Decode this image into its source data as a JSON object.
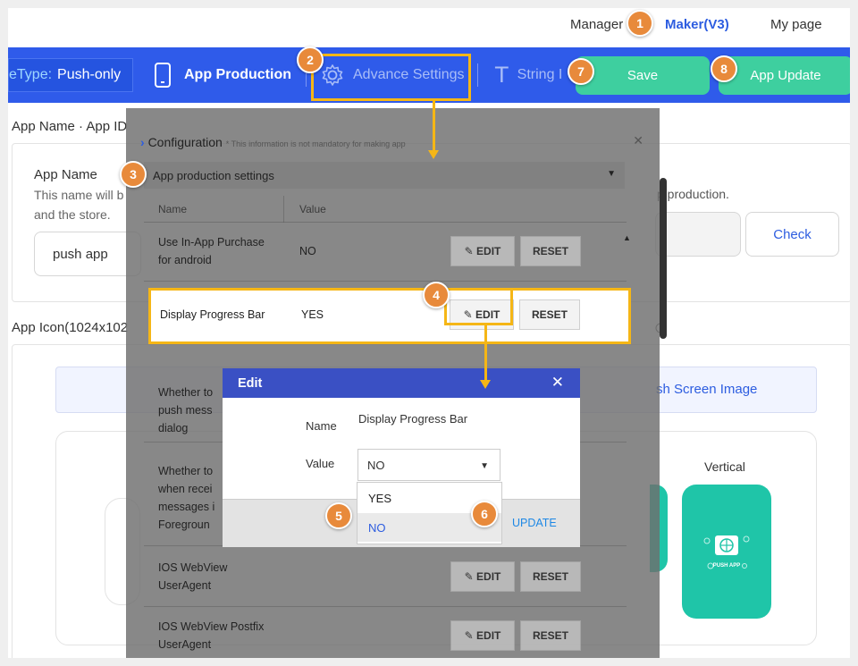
{
  "topnav": {
    "manager": "Manager",
    "maker": "Maker(V3)",
    "mypage": "My page"
  },
  "bluebar": {
    "apptype_prefix": "eType:",
    "apptype_value": "Push-only",
    "app_production": "App Production",
    "advance_settings": "Advance Settings",
    "string": "String I",
    "save": "Save",
    "app_update": "App Update"
  },
  "background": {
    "section_appname": "App Name · App ID",
    "app_name_label": "App Name",
    "app_name_desc1": "This name will b",
    "app_name_desc2": "and the store.",
    "app_name_value": "push app",
    "app_production_note": "p production.",
    "check": "Check",
    "section_icon": "App Icon(1024x102",
    "splash_label": "sh Screen Image",
    "vertical": "Vertical",
    "push_app_caption": "PUSH APP"
  },
  "config": {
    "title": "Configuration",
    "subtitle": "* This information is not mandatory for making app",
    "section": "App production settings",
    "col_name": "Name",
    "col_value": "Value",
    "edit": "EDIT",
    "reset": "RESET",
    "rows": [
      {
        "name1": "Use In-App Purchase",
        "name2": "for android",
        "value": "NO"
      },
      {
        "name1": "Display Progress Bar",
        "value": "YES"
      },
      {
        "name1": "Whether to",
        "name2": "push mess",
        "name3": "dialog"
      },
      {
        "name1": "Whether to",
        "name2": "when recei",
        "name3": "messages i",
        "name4": "Foregroun"
      },
      {
        "name1": "IOS WebView",
        "name2": "UserAgent"
      },
      {
        "name1": "IOS WebView Postfix",
        "name2": "UserAgent"
      }
    ]
  },
  "dialog": {
    "title": "Edit",
    "name_label": "Name",
    "name_value": "Display Progress Bar",
    "value_label": "Value",
    "selected": "NO",
    "options": [
      "YES",
      "NO"
    ],
    "update": "UPDATE"
  },
  "badges": [
    "1",
    "2",
    "3",
    "4",
    "5",
    "6",
    "7",
    "8"
  ],
  "colors": {
    "blue": "#2f5bea",
    "green": "#3ecf9f",
    "callout": "#e88a3b",
    "highlight": "#f5b616",
    "dialog_head": "#3a50c4"
  }
}
